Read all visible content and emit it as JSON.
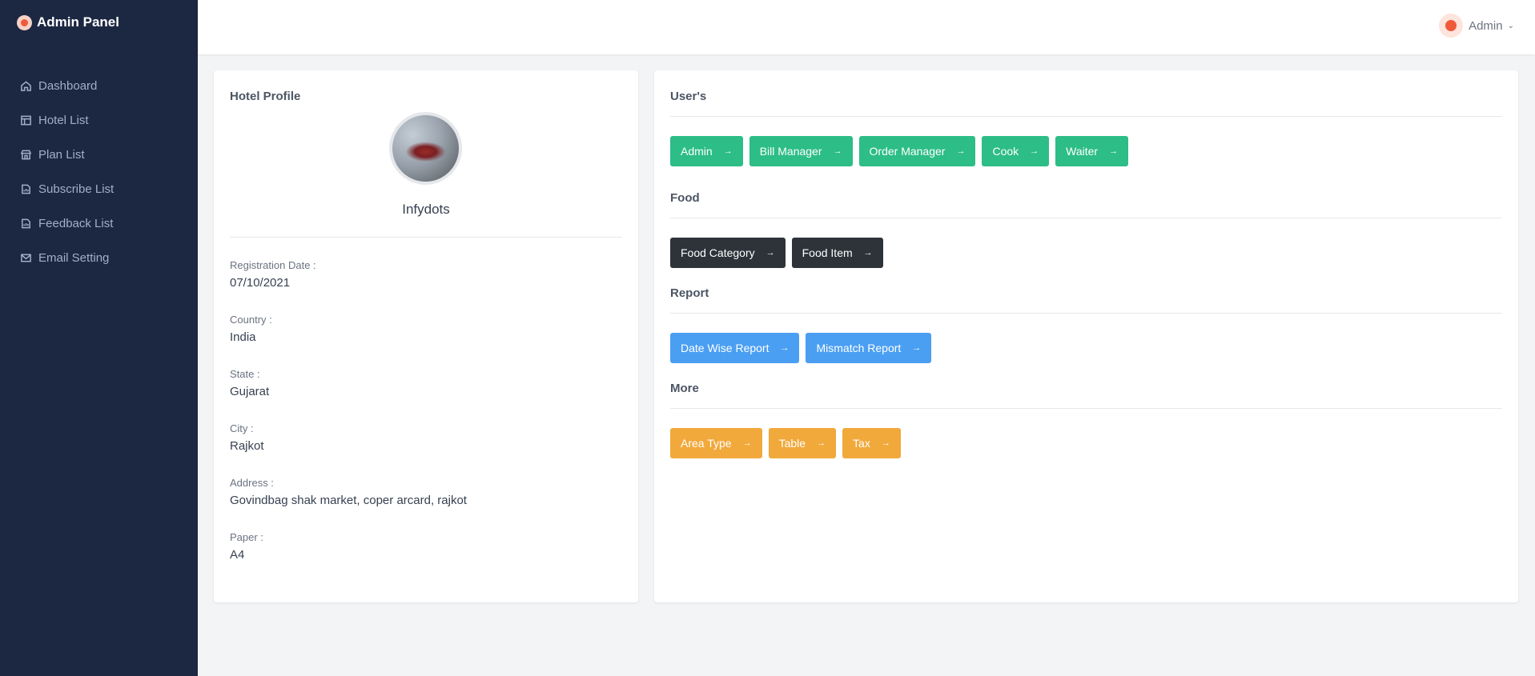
{
  "brand": {
    "title": "Admin Panel"
  },
  "sidebar": {
    "items": [
      {
        "label": "Dashboard",
        "icon": "home-icon"
      },
      {
        "label": "Hotel List",
        "icon": "table-icon"
      },
      {
        "label": "Plan List",
        "icon": "store-icon"
      },
      {
        "label": "Subscribe List",
        "icon": "report-icon"
      },
      {
        "label": "Feedback List",
        "icon": "report-icon"
      },
      {
        "label": "Email Setting",
        "icon": "mail-icon"
      }
    ]
  },
  "topbar": {
    "user_name": "Admin",
    "chevron": "⌄"
  },
  "profile": {
    "title": "Hotel Profile",
    "hotel_name": "Infydots",
    "fields": [
      {
        "label": "Registration Date :",
        "value": "07/10/2021"
      },
      {
        "label": "Country :",
        "value": "India"
      },
      {
        "label": "State :",
        "value": "Gujarat"
      },
      {
        "label": "City :",
        "value": "Rajkot"
      },
      {
        "label": "Address :",
        "value": "Govindbag shak market, coper arcard, rajkot"
      },
      {
        "label": "Paper :",
        "value": "A4"
      }
    ]
  },
  "sections": {
    "users": {
      "title": "User's",
      "buttons": [
        "Admin",
        "Bill Manager",
        "Order Manager",
        "Cook",
        "Waiter"
      ],
      "color": "#2dbd87"
    },
    "food": {
      "title": "Food",
      "buttons": [
        "Food Category",
        "Food Item"
      ],
      "color": "#2d3339"
    },
    "report": {
      "title": "Report",
      "buttons": [
        "Date Wise Report",
        "Mismatch Report"
      ],
      "color": "#4b9ff2"
    },
    "more": {
      "title": "More",
      "buttons": [
        "Area Type",
        "Table",
        "Tax"
      ],
      "color": "#f1a93c"
    }
  },
  "arrow": "→",
  "colors": {
    "sidebar_bg": "#1c2742",
    "brand_accent": "#ef5a3c",
    "page_bg": "#f3f4f6"
  }
}
